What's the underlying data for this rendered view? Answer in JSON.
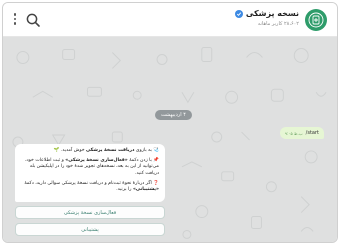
{
  "header": {
    "title": "نسخه پزشکی",
    "subtitle": "۲۸،۶۰۲ کاربر ماهانه",
    "avatar_icon": "prescription-logo-icon",
    "menu_icon": "more-vertical-icon",
    "search_icon": "search-icon"
  },
  "chat": {
    "date_label": "۴ اردیبهشت",
    "outgoing": {
      "text": "/start",
      "time": "۹:۰۵ ب.ظ"
    },
    "incoming": {
      "line1_pre": "به بازوی ",
      "line1_bold": "دریافت نسخهٔ پزشکی",
      "line1_post": " خوش آمدید.",
      "line2_pre": "با زدن دکمهٔ ",
      "line2_bold": "«فعال‌سازی نسخهٔ پزشکی»",
      "line2_post": " و ثبت اطلاعات خود، می‌توانید از این به بعد، نسخه‌های تجویز شدهٔ خود را در اپلیکیشن بله دریافت کنید.",
      "line3_pre": "اگر دربارهٔ نحوهٔ ثبت‌نام و دریافت نسخهٔ پزشکی سوالی دارید، دکمهٔ ",
      "line3_bold": "«پشتیبانی»",
      "line3_post": " را بزنید."
    },
    "buttons": {
      "activate": "فعال‌سازی نسخهٔ پزشکی",
      "support": "پشتیبانی"
    }
  },
  "colors": {
    "avatar_bg": "#2e9c6a",
    "verified": "#3d8ae3",
    "chat_bg": "#dfe0e0",
    "outgoing_bubble": "#e6f6d4",
    "button_text": "#3a7e6f"
  }
}
